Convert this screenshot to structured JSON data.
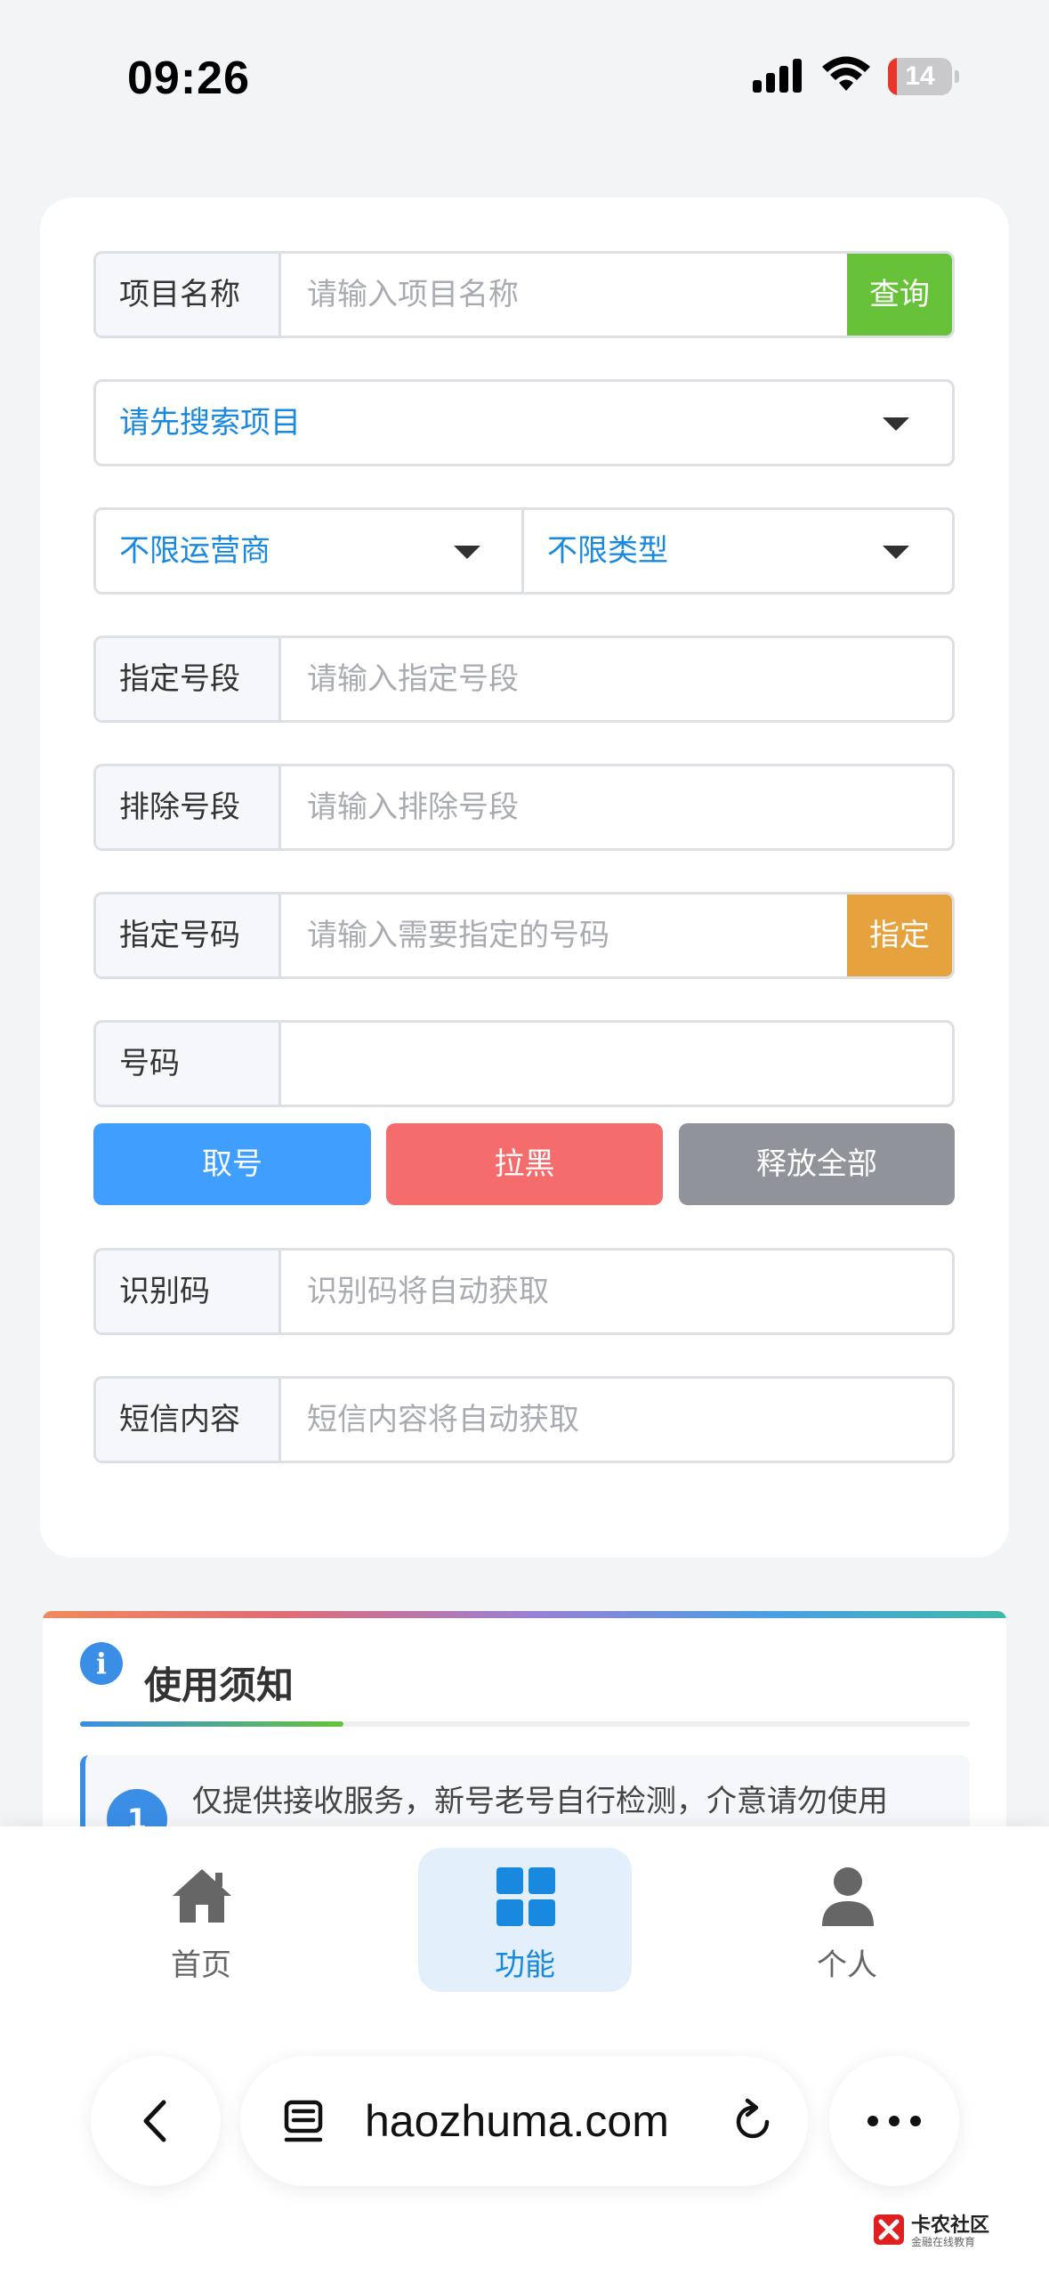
{
  "status": {
    "time": "09:26",
    "battery": "14",
    "battery_level": 0.14,
    "battery_color": "#e8352d"
  },
  "form": {
    "project": {
      "label": "项目名称",
      "placeholder": "请输入项目名称",
      "button": "查询"
    },
    "project_select": {
      "value": "请先搜索项目"
    },
    "operator_select": {
      "value": "不限运营商"
    },
    "type_select": {
      "value": "不限类型"
    },
    "segment_include": {
      "label": "指定号段",
      "placeholder": "请输入指定号段"
    },
    "segment_exclude": {
      "label": "排除号段",
      "placeholder": "请输入排除号段"
    },
    "specify_number": {
      "label": "指定号码",
      "placeholder": "请输入需要指定的号码",
      "button": "指定"
    },
    "number": {
      "label": "号码",
      "value": ""
    },
    "actions": {
      "get": "取号",
      "block": "拉黑",
      "release_all": "释放全部"
    },
    "code": {
      "label": "识别码",
      "placeholder": "识别码将自动获取"
    },
    "sms": {
      "label": "短信内容",
      "placeholder": "短信内容将自动获取"
    }
  },
  "notice": {
    "icon": "i",
    "title": "使用须知",
    "items": [
      {
        "num": "1",
        "text": "仅提供接收服务，新号老号自行检测，介意请勿使用"
      }
    ]
  },
  "tabbar": {
    "home": "首页",
    "features": "功能",
    "profile": "个人"
  },
  "browser": {
    "url": "haozhuma.com"
  },
  "watermark": {
    "title": "卡农社区",
    "subtitle": "金融在线教育"
  },
  "colors": {
    "primary": "#409eff",
    "danger": "#f56c6c",
    "info": "#909399",
    "success": "#67c23a",
    "warning": "#e6a23c",
    "link": "#1989e0"
  }
}
